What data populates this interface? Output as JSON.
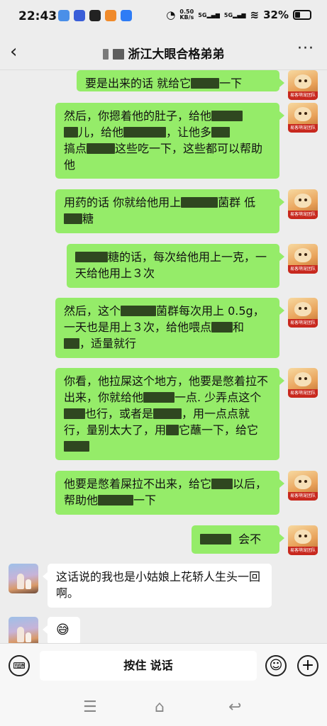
{
  "status_bar": {
    "time": "22:43",
    "net_speed": "0.50",
    "net_unit": "KB/s",
    "sig1": "5G",
    "sig2": "5G",
    "battery": "32%"
  },
  "header": {
    "title": "浙江大眼合格弟弟",
    "back_icon": "chevron-left-icon",
    "more_icon": "ellipsis-icon"
  },
  "messages": [
    {
      "side": "me",
      "parts": [
        "要是出来的话 就给它",
        "一下"
      ]
    },
    {
      "side": "me",
      "parts": [
        "然后，你摁着他的肚子，给他",
        "儿，给他",
        "，让他多",
        "搞点",
        "这些吃一下，这些都可以帮助他"
      ]
    },
    {
      "side": "me",
      "parts": [
        "用药的话 你就给他用上",
        "菌群  低",
        "糖"
      ]
    },
    {
      "side": "me",
      "parts": [
        "糖的话，每次给他用上一克，一天给他用上３次"
      ]
    },
    {
      "side": "me",
      "parts": [
        "然后，这个",
        "菌群每次用上 0.5g，一天也是用上３次，给他喂点",
        "和",
        "，适量就行"
      ]
    },
    {
      "side": "me",
      "parts": [
        "你看，他拉屎这个地方，他要是憋着拉不出来，你就给他",
        "一点. 少弄点这个",
        "也行，或者是",
        "，用一点点就行，量别太大了，用",
        "它蘸一下，给它"
      ]
    },
    {
      "side": "me",
      "parts": [
        "他要是憋着屎拉不出来，给它",
        "以后，帮助他",
        "一下"
      ]
    },
    {
      "side": "me",
      "parts": [
        "会不"
      ]
    },
    {
      "side": "other",
      "parts": [
        "这话说的我也是小姑娘上花轿人生头一回啊。"
      ]
    },
    {
      "side": "other",
      "parts": [
        "😅"
      ]
    }
  ],
  "avatar_band_text": "易客萌宠团队",
  "input_bar": {
    "hold_to_talk": "按住 说话",
    "keyboard_icon": "keyboard-icon",
    "emoji_icon": "smile-icon",
    "plus_icon": "plus-icon"
  },
  "nav_bar": {
    "menu_icon": "menu-icon",
    "home_icon": "home-icon",
    "back_icon": "back-icon"
  }
}
